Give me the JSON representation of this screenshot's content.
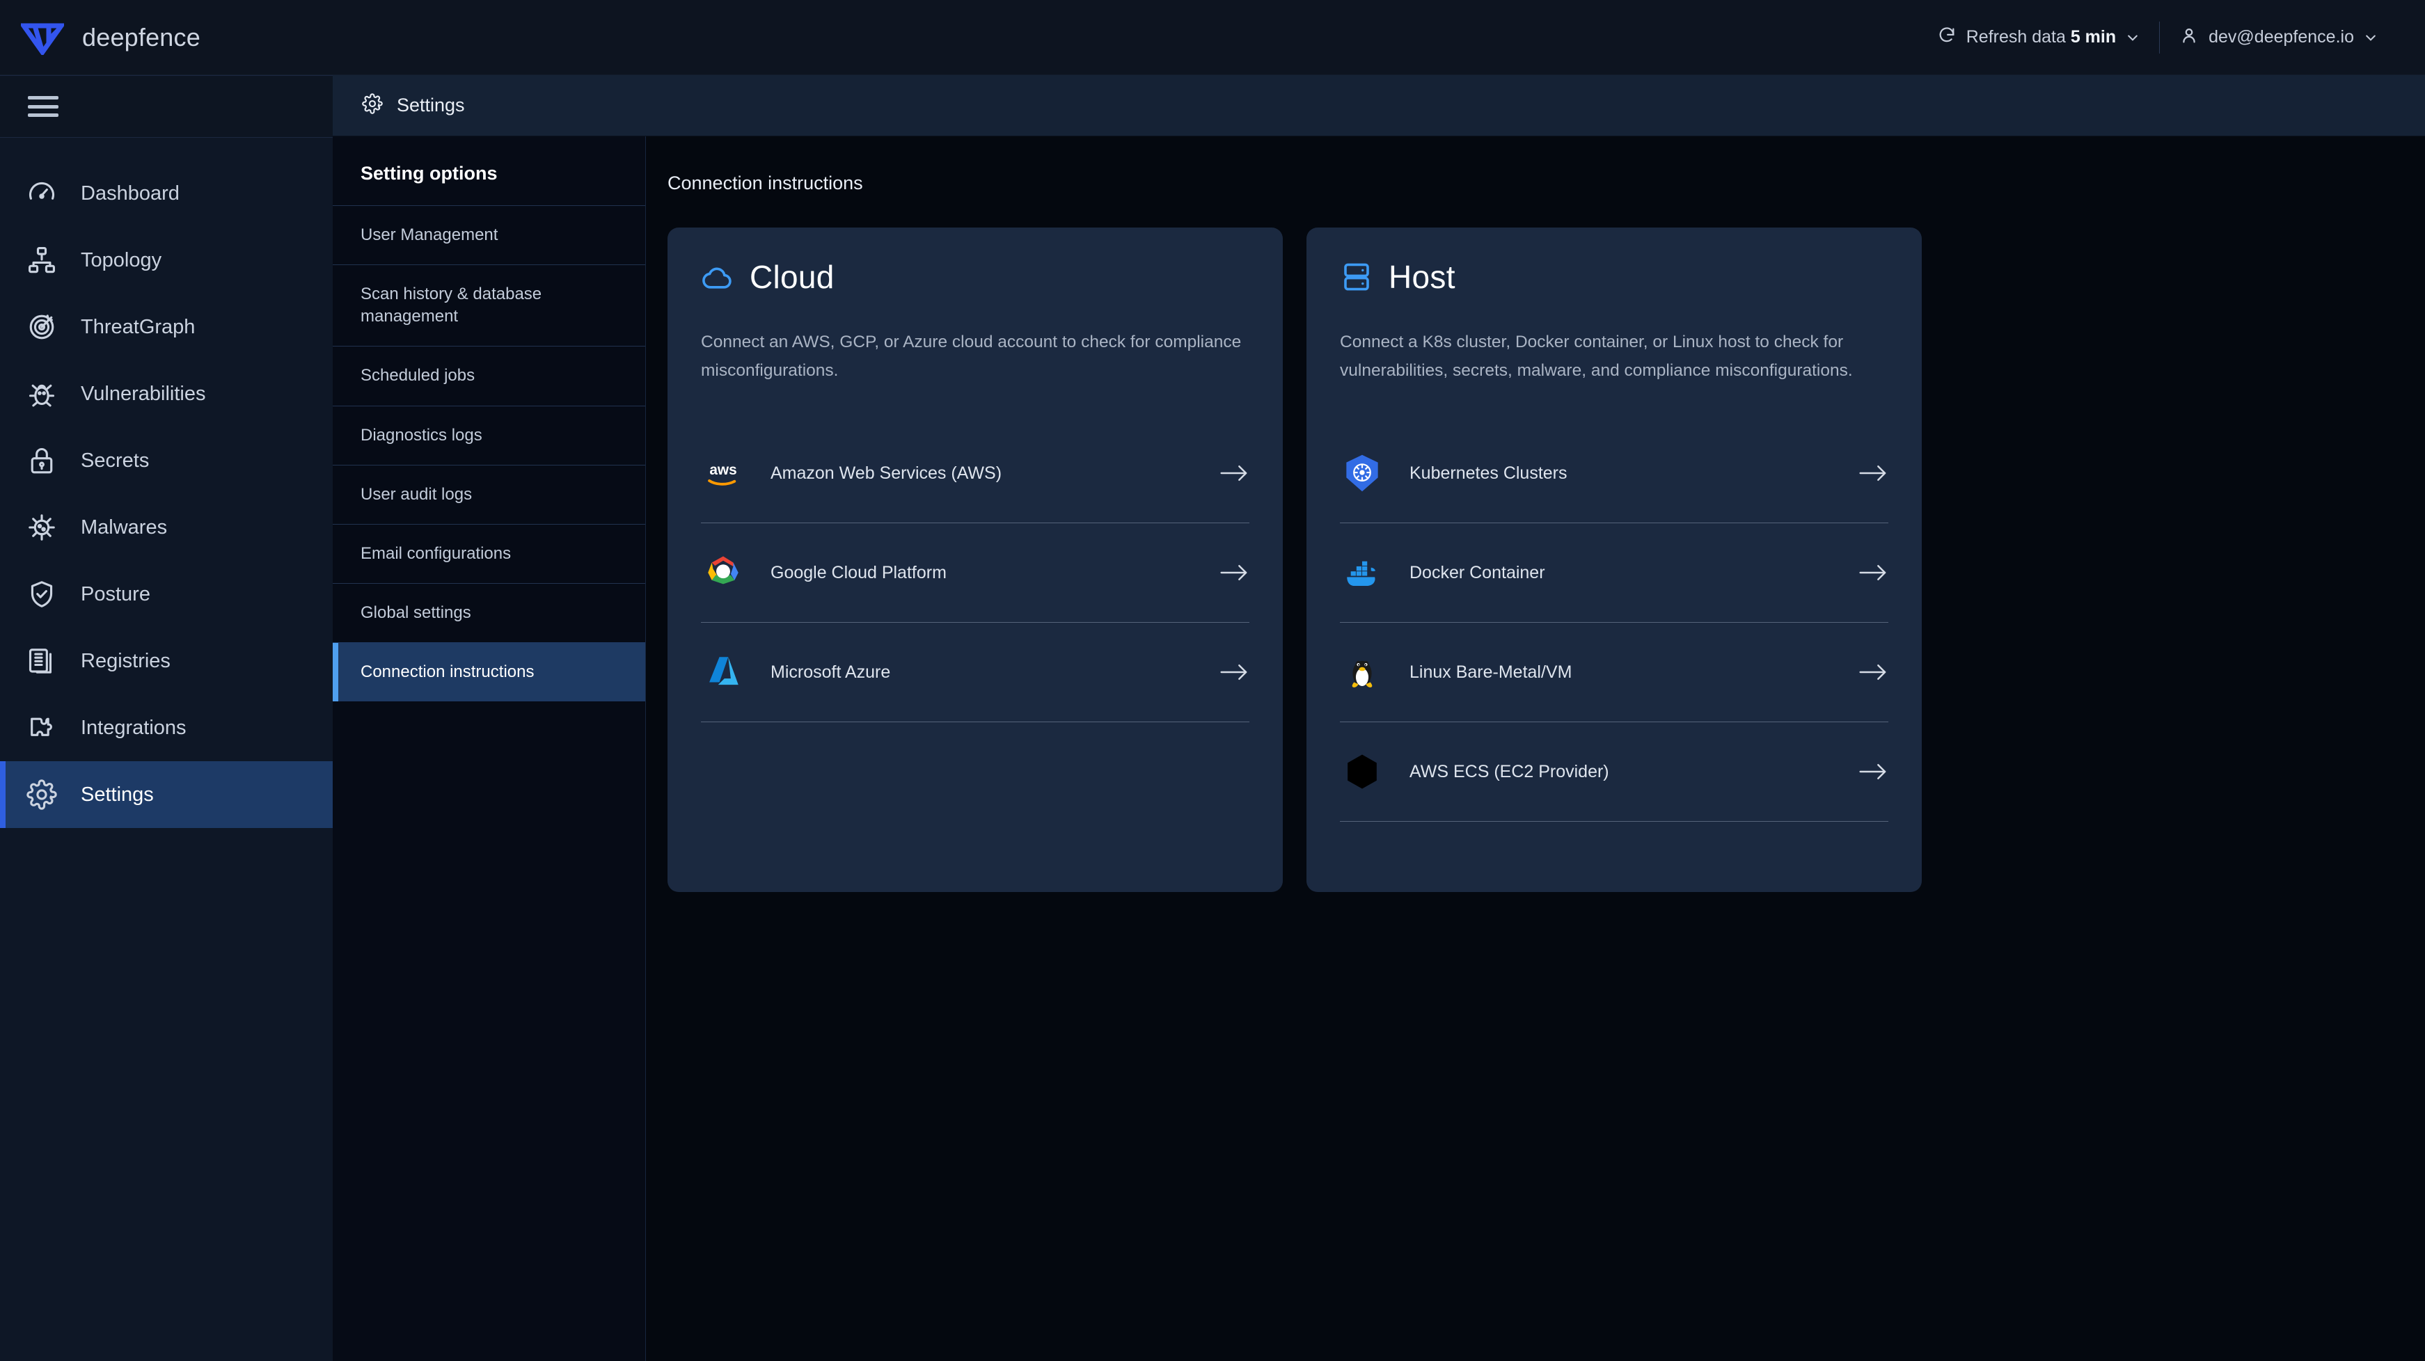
{
  "brand": {
    "name": "deepfence",
    "logo_icon": "deepfence-logo"
  },
  "topbar": {
    "refresh": {
      "label_prefix": "Refresh data",
      "value": "5 min",
      "icon": "refresh-icon",
      "chevron": "chevron-down-icon"
    },
    "user": {
      "email": "dev@deepfence.io",
      "icon": "user-icon",
      "chevron": "chevron-down-icon"
    }
  },
  "sidebar": {
    "menu_icon": "hamburger-icon",
    "items": [
      {
        "label": "Dashboard",
        "icon": "gauge-icon",
        "active": false
      },
      {
        "label": "Topology",
        "icon": "topology-icon",
        "active": false
      },
      {
        "label": "ThreatGraph",
        "icon": "target-icon",
        "active": false
      },
      {
        "label": "Vulnerabilities",
        "icon": "bug-icon",
        "active": false
      },
      {
        "label": "Secrets",
        "icon": "lock-icon",
        "active": false
      },
      {
        "label": "Malwares",
        "icon": "virus-icon",
        "active": false
      },
      {
        "label": "Posture",
        "icon": "shield-check-icon",
        "active": false
      },
      {
        "label": "Registries",
        "icon": "documents-icon",
        "active": false
      },
      {
        "label": "Integrations",
        "icon": "puzzle-icon",
        "active": false
      },
      {
        "label": "Settings",
        "icon": "gear-icon",
        "active": true
      }
    ]
  },
  "page_header": {
    "title": "Settings",
    "icon": "gear-icon"
  },
  "settings_panel": {
    "title": "Setting options",
    "options": [
      {
        "label": "User Management",
        "selected": false
      },
      {
        "label": "Scan history & database management",
        "selected": false
      },
      {
        "label": "Scheduled jobs",
        "selected": false
      },
      {
        "label": "Diagnostics logs",
        "selected": false
      },
      {
        "label": "User audit logs",
        "selected": false
      },
      {
        "label": "Email configurations",
        "selected": false
      },
      {
        "label": "Global settings",
        "selected": false
      },
      {
        "label": "Connection instructions",
        "selected": true
      }
    ]
  },
  "main": {
    "title": "Connection instructions",
    "cards": [
      {
        "title": "Cloud",
        "icon": "cloud-icon",
        "description": "Connect an AWS, GCP, or Azure cloud account to check for compliance misconfigurations.",
        "rows": [
          {
            "label": "Amazon Web Services (AWS)",
            "logo": "aws-logo",
            "arrow": "arrow-right-icon"
          },
          {
            "label": "Google Cloud Platform",
            "logo": "gcp-logo",
            "arrow": "arrow-right-icon"
          },
          {
            "label": "Microsoft Azure",
            "logo": "azure-logo",
            "arrow": "arrow-right-icon"
          }
        ]
      },
      {
        "title": "Host",
        "icon": "server-icon",
        "description": "Connect a K8s cluster, Docker container, or Linux host to check for vulnerabilities, secrets, malware, and compliance misconfigurations.",
        "rows": [
          {
            "label": "Kubernetes Clusters",
            "logo": "kubernetes-logo",
            "arrow": "arrow-right-icon"
          },
          {
            "label": "Docker Container",
            "logo": "docker-logo",
            "arrow": "arrow-right-icon"
          },
          {
            "label": "Linux Bare-Metal/VM",
            "logo": "linux-logo",
            "arrow": "arrow-right-icon"
          },
          {
            "label": "AWS ECS (EC2 Provider)",
            "logo": "aws-ecs-logo",
            "arrow": "arrow-right-icon"
          }
        ]
      }
    ]
  },
  "colors": {
    "page_bg": "#04080f",
    "sidebar_bg": "#0e1726",
    "card_bg": "#1b2940",
    "accent_blue": "#2f5fe0",
    "selected_blue": "#1e3a63",
    "highlight_bar": "#4f9fef",
    "brand_blue": "#3355ee"
  }
}
